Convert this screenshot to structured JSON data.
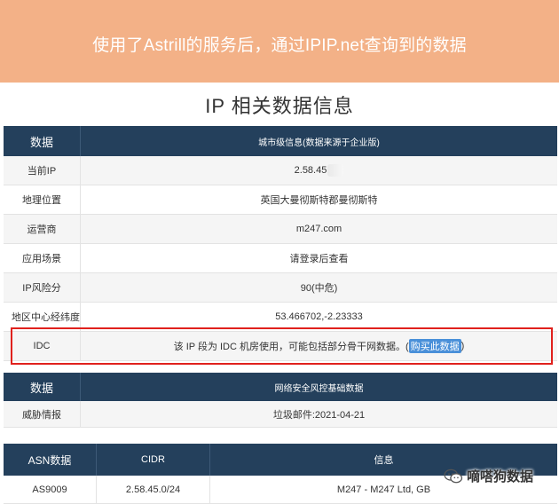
{
  "banner": {
    "text": "使用了Astrill的服务后，通过IPIP.net查询到的数据",
    "color": "#f3b187"
  },
  "page_title": "IP 相关数据信息",
  "city_table": {
    "header": {
      "col1": "数据",
      "col2": "城市级信息(数据来源于企业版)"
    },
    "rows": [
      {
        "label": "当前IP",
        "value": "2.58.45"
      },
      {
        "label": "地理位置",
        "value": "英国大曼彻斯特郡曼彻斯特"
      },
      {
        "label": "运营商",
        "value": "m247.com"
      },
      {
        "label": "应用场景",
        "value": "请登录后查看"
      },
      {
        "label": "IP风险分",
        "value": "90(中危)"
      },
      {
        "label": "地区中心经纬度",
        "value": "53.466702,-2.23333"
      },
      {
        "label": "IDC",
        "value_prefix": "该 IP 段为 IDC 机房使用，可能包括部分骨干网数据。(",
        "link": "购买此数据",
        "value_suffix": ")"
      }
    ]
  },
  "security_table": {
    "header": {
      "col1": "数据",
      "col2": "网络安全风控基础数据"
    },
    "rows": [
      {
        "label": "威胁情报",
        "value": "垃圾邮件:2021-04-21"
      }
    ]
  },
  "asn_table": {
    "header": {
      "col1": "ASN数据",
      "col2": "CIDR",
      "col3": "信息"
    },
    "rows": [
      {
        "asn": "AS9009",
        "cidr": "2.58.45.0/24",
        "info": "M247 - M247 Ltd, GB"
      }
    ]
  },
  "watermark": {
    "text": "嘀嗒狗数据",
    "icon": "wechat-icon"
  },
  "colors": {
    "header_bg": "#24405c",
    "highlight_border": "#e0211d",
    "link_bg": "#4a90d9"
  }
}
